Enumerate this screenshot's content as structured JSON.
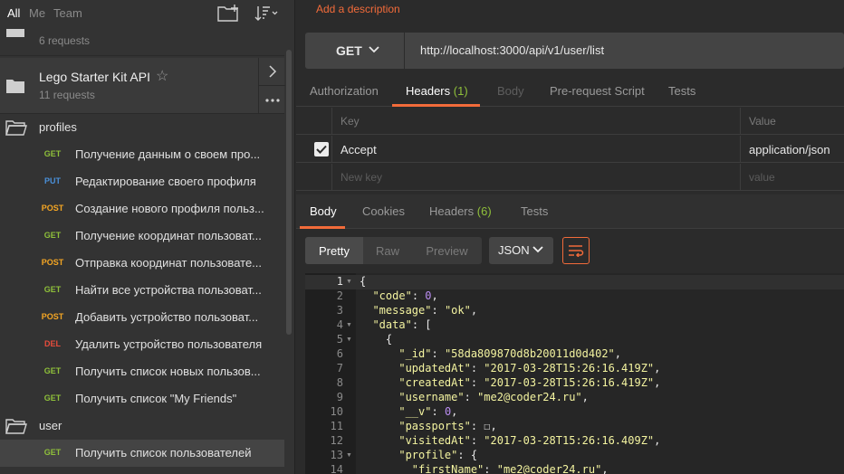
{
  "sidebar": {
    "tabs": [
      {
        "label": "All",
        "active": true
      },
      {
        "label": "Me",
        "active": false
      },
      {
        "label": "Team",
        "active": false
      }
    ],
    "prev_collection": {
      "requests": "6 requests"
    },
    "collection": {
      "name": "Lego Starter Kit API",
      "requests": "11 requests"
    },
    "folders": {
      "profiles": "profiles",
      "user": "user"
    },
    "requests": [
      {
        "method": "GET",
        "name": "Получение данным о своем про..."
      },
      {
        "method": "PUT",
        "name": "Редактирование своего профиля"
      },
      {
        "method": "POST",
        "name": "Создание нового профиля польз..."
      },
      {
        "method": "GET",
        "name": "Получение координат пользоват..."
      },
      {
        "method": "POST",
        "name": "Отправка координат пользовате..."
      },
      {
        "method": "GET",
        "name": "Найти все устройства пользоват..."
      },
      {
        "method": "POST",
        "name": "Добавить устройство пользоват..."
      },
      {
        "method": "DEL",
        "name": "Удалить устройство пользователя"
      },
      {
        "method": "GET",
        "name": "Получить список новых пользов..."
      },
      {
        "method": "GET",
        "name": "Получить список \"My Friends\""
      }
    ],
    "user_requests": [
      {
        "method": "GET",
        "name": "Получить список пользователей"
      }
    ]
  },
  "colors": {
    "GET": "#8fc03a",
    "PUT": "#4a90d9",
    "POST": "#f5a623",
    "DEL": "#e74c3c",
    "accent": "#f26b3a"
  },
  "request": {
    "add_description": "Add a description",
    "method": "GET",
    "url": "http://localhost:3000/api/v1/user/list",
    "tabs": {
      "authorization": "Authorization",
      "headers": "Headers",
      "headers_count": "(1)",
      "body": "Body",
      "prerequest": "Pre-request Script",
      "tests": "Tests"
    },
    "headers_table": {
      "key_header": "Key",
      "value_header": "Value",
      "rows": [
        {
          "key": "Accept",
          "value": "application/json",
          "enabled": true
        }
      ],
      "new_key_placeholder": "New key",
      "new_value_placeholder": "value"
    }
  },
  "response": {
    "tabs": {
      "body": "Body",
      "cookies": "Cookies",
      "headers": "Headers",
      "headers_count": "(6)",
      "tests": "Tests"
    },
    "formats": {
      "pretty": "Pretty",
      "raw": "Raw",
      "preview": "Preview"
    },
    "language": "JSON",
    "line_numbers": [
      "1",
      "2",
      "3",
      "4",
      "5",
      "6",
      "7",
      "8",
      "9",
      "10",
      "11",
      "12",
      "13",
      "14"
    ],
    "code": {
      "l3_key": "\"code\"",
      "l3_val": "0",
      "l4_key": "\"message\"",
      "l4_val": "\"ok\"",
      "l5_key": "\"data\"",
      "l6_id_key": "\"_id\"",
      "l6_id_val": "\"58da809870d8b20011d0d402\"",
      "l7_key": "\"updatedAt\"",
      "l7_val": "\"2017-03-28T15:26:16.419Z\"",
      "l8_key": "\"createdAt\"",
      "l8_val": "\"2017-03-28T15:26:16.419Z\"",
      "l9_key": "\"username\"",
      "l9_val": "\"me2@coder24.ru\"",
      "l10_key": "\"__v\"",
      "l10_val": "0",
      "l11_key": "\"passports\"",
      "l12_key": "\"visitedAt\"",
      "l12_val": "\"2017-03-28T15:26:16.409Z\"",
      "l13_key": "\"profile\"",
      "l14_key": "\"firstName\"",
      "l14_val": "\"me2@coder24.ru\""
    }
  }
}
